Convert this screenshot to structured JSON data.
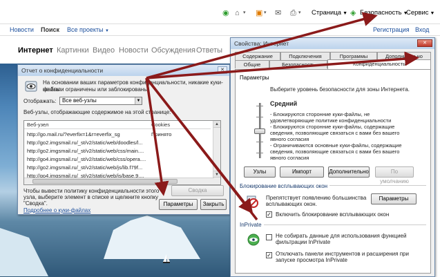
{
  "toolbar": {
    "page_label": "Страница",
    "security_label": "Безопасность",
    "service_label": "Сервис"
  },
  "sitenav": {
    "news": "Новости",
    "search": "Поиск",
    "all_projects": "Все проекты",
    "register": "Регистрация",
    "login": "Вход"
  },
  "search_tabs": [
    "Интернет",
    "Картинки",
    "Видео",
    "Новости",
    "Обсуждения",
    "Ответы"
  ],
  "privacy": {
    "title": "Отчет о конфиденциальности",
    "info_line1": "На основании ваших параметров конфиденциальности, никакие куки-файлы",
    "info_line2": "не были ограничены или заблокированы.",
    "show_label": "Отображать:",
    "show_value": "Все веб-узлы",
    "list_caption": "Веб-узлы, отображающие содержимое на этой странице:",
    "col_site": "Веб-узел",
    "col_cookies": "Cookies",
    "rows": [
      {
        "url": "http://go.mail.ru/?everfix=1&r=everfix_sg",
        "cookie": "Принято"
      },
      {
        "url": "http://go2.imgsmail.ru/_st/v2/static/web/doodles/l...",
        "cookie": ""
      },
      {
        "url": "http://go2.imgsmail.ru/_st/v2/static/web/css/main....",
        "cookie": ""
      },
      {
        "url": "http://go4.imgsmail.ru/_st/v2/static/web/css/opera....",
        "cookie": ""
      },
      {
        "url": "http://go2.imgsmail.ru/_st/v2/static/web/js/lib.f79f...",
        "cookie": ""
      },
      {
        "url": "http://go4.imgsmail.ru/_st/v2/static/web/js/base.9....",
        "cookie": ""
      }
    ],
    "hint_line1": "Чтобы вывести политику конфиденциальности этого",
    "hint_line2": "узла, выберите элемент в списке и щелкните кнопку",
    "hint_line3": "\"Сводка\".",
    "summary_button": "Сводка",
    "cookie_link": "Подробнее о куки-файлах",
    "params_button": "Параметры",
    "close_button": "Закрыть",
    "close_x": "✕"
  },
  "options": {
    "title": "Свойства: Интернет",
    "close_x": "✕",
    "tabs_row1": [
      "Содержание",
      "Подключения",
      "Программы",
      "Дополнительно"
    ],
    "tabs_row2": [
      "Общие",
      "Безопасность",
      "Конфиденциальность"
    ],
    "params_title": "Параметры",
    "zone_text": "Выберите уровень безопасности для зоны Интернета.",
    "level_name": "Средний",
    "bullet1_l1": "- Блокируются сторонние куки-файлы, не",
    "bullet1_l2": "удовлетворяющие политике конфиденциальности",
    "bullet2_l1": "- Блокируются сторонние куки-файлы, содержащие",
    "bullet2_l2": "сведения, позволяющие связаться с вами без вашего",
    "bullet2_l3": "явного согласия",
    "bullet3_l1": "- Ограничиваются основные куки-файлы, содержащие",
    "bullet3_l2": "сведения, позволяющие связаться с вами без вашего",
    "bullet3_l3": "явного согласия",
    "btn_sites": "Узлы",
    "btn_import": "Импорт",
    "btn_advanced": "Дополнительно",
    "btn_default": "По умолчанию",
    "popup_title": "Блокирование всплывающих окон",
    "popup_text_l1": "Препятствует появлению большинства",
    "popup_text_l2": "всплывающих окон.",
    "popup_params": "Параметры",
    "popup_enable": "Включить блокирование всплывающих окон",
    "inprivate_title": "InPrivate",
    "inp1_l1": "Не собирать данные для использования функцией",
    "inp1_l2": "фильтрации InPrivate",
    "inp2_l1": "Отключать панели инструментов и расширения при",
    "inp2_l2": "запуске просмотра InPrivate",
    "check_mark": "✓"
  },
  "colors": {
    "arrow": "#8b1a1a",
    "link": "#1a4e9c"
  }
}
